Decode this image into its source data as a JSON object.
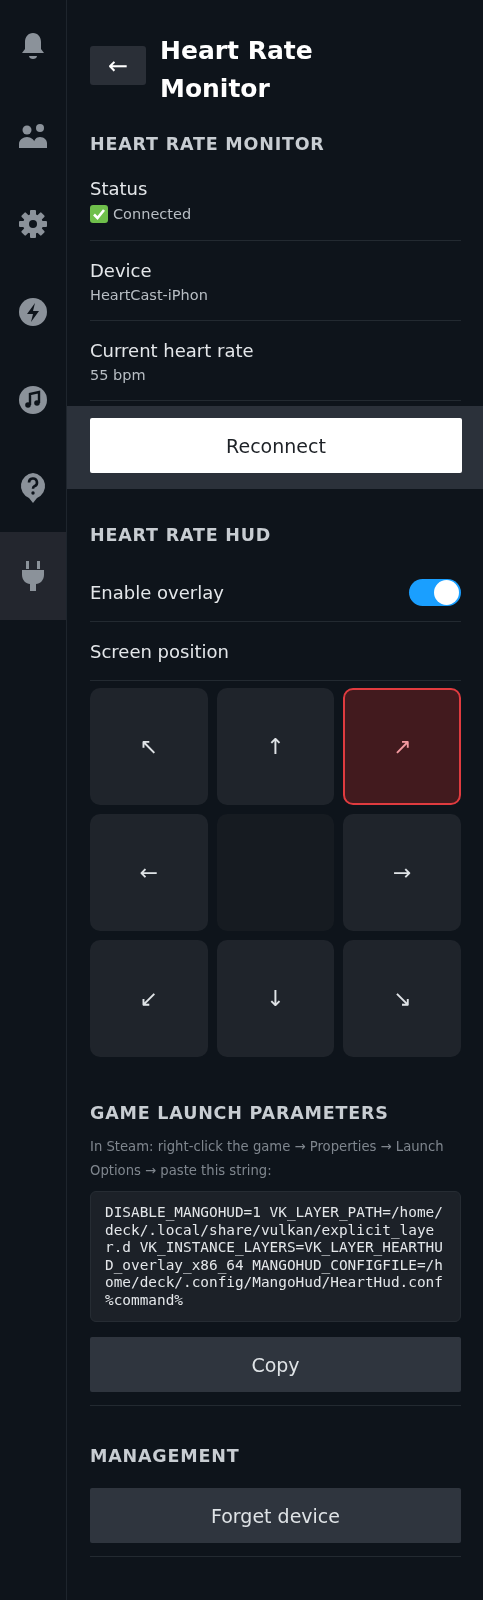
{
  "sidebar": {
    "items": [
      {
        "selected": false
      },
      {
        "selected": false
      },
      {
        "selected": false
      },
      {
        "selected": false
      },
      {
        "selected": false
      },
      {
        "selected": false
      },
      {
        "selected": true
      }
    ]
  },
  "header": {
    "back": "←",
    "title": "Heart Rate Monitor"
  },
  "monitor": {
    "heading": "HEART RATE MONITOR",
    "fields": [
      {
        "label": "Status",
        "value": "Connected",
        "ok": true
      },
      {
        "label": "Device",
        "value": "HeartCast-iPhon",
        "ok": false
      },
      {
        "label": "Current heart rate",
        "value": "55 bpm",
        "ok": false
      }
    ],
    "button": "Reconnect"
  },
  "hud": {
    "heading": "HEART RATE HUD",
    "overlay": {
      "label": "Enable overlay",
      "on": true
    },
    "position_label": "Screen position",
    "positions": [
      {
        "kind": "arrow",
        "label": "↖",
        "selected": false
      },
      {
        "kind": "arrow",
        "label": "↑",
        "selected": false
      },
      {
        "kind": "arrow",
        "label": "↗",
        "selected": true
      },
      {
        "kind": "arrow",
        "label": "←",
        "selected": false
      },
      {
        "kind": "blank",
        "selected": false
      },
      {
        "kind": "arrow",
        "label": "→",
        "selected": false
      },
      {
        "kind": "arrow",
        "label": "↙",
        "selected": false
      },
      {
        "kind": "arrow",
        "label": "↓",
        "selected": false
      },
      {
        "kind": "arrow",
        "label": "↘",
        "selected": false
      }
    ]
  },
  "launch": {
    "heading": "GAME LAUNCH PARAMETERS",
    "hint": "In Steam: right-click the game → Properties → Launch Options → paste this string:",
    "code": "DISABLE_MANGOHUD=1 VK_LAYER_PATH=/home/deck/.local/share/vulkan/explicit_layer.d VK_INSTANCE_LAYERS=VK_LAYER_HEARTHUD_overlay_x86_64 MANGOHUD_CONFIGFILE=/home/deck/.config/MangoHud/HeartHud.conf %command%",
    "button": "Copy"
  },
  "management": {
    "heading": "MANAGEMENT",
    "button": "Forget device"
  }
}
